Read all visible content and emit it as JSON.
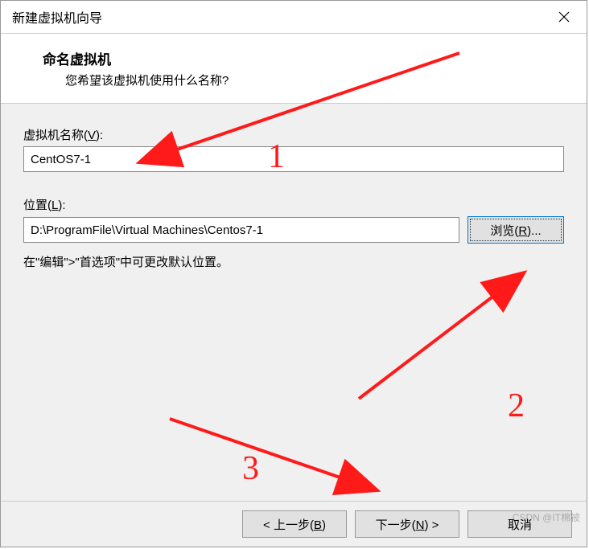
{
  "title": "新建虚拟机向导",
  "header": {
    "title": "命名虚拟机",
    "sub": "您希望该虚拟机使用什么名称?"
  },
  "nameField": {
    "labelPrefix": "虚拟机名称(",
    "labelKey": "V",
    "labelSuffix": "):",
    "value": "CentOS7-1"
  },
  "locField": {
    "labelPrefix": "位置(",
    "labelKey": "L",
    "labelSuffix": "):",
    "value": "D:\\ProgramFile\\Virtual Machines\\Centos7-1"
  },
  "browse": {
    "pre": "浏览(",
    "key": "R",
    "post": ")..."
  },
  "hint": "在\"编辑\">\"首选项\"中可更改默认位置。",
  "buttons": {
    "back": {
      "pre": "< 上一步(",
      "key": "B",
      "post": ")"
    },
    "next": {
      "pre": "下一步(",
      "key": "N",
      "post": ") >"
    },
    "cancel": "取消"
  },
  "anno": {
    "n1": "1",
    "n2": "2",
    "n3": "3"
  },
  "watermark": "CSDN @IT棉被"
}
